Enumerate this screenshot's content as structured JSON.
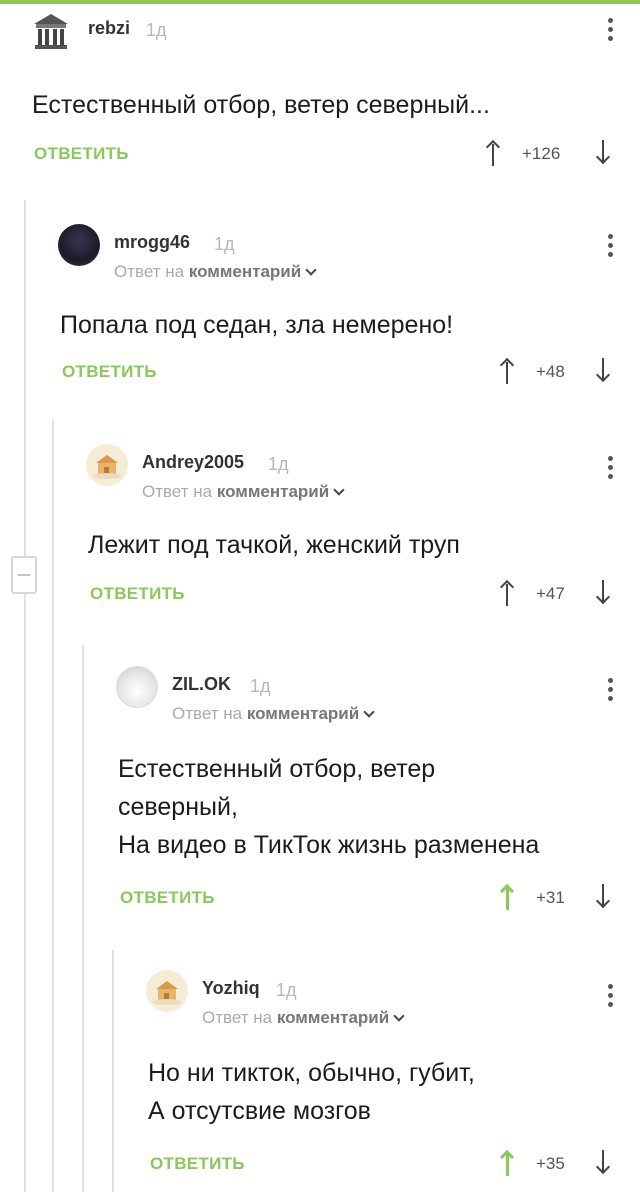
{
  "comments": [
    {
      "username": "rebzi",
      "time": "1д",
      "reply_to": null,
      "text": "Естественный отбор, ветер северный...",
      "reply_label": "ОТВЕТИТЬ",
      "rating": "+126",
      "upvoted": false,
      "avatar": "building-avatar"
    },
    {
      "username": "mrogg46",
      "time": "1д",
      "reply_to": {
        "prefix": "Ответ на",
        "target": "комментарий"
      },
      "text": "Попала под седан, зла немерено!",
      "reply_label": "ОТВЕТИТЬ",
      "rating": "+48",
      "upvoted": false,
      "avatar": "dark-photo-avatar"
    },
    {
      "username": "Andrey2005",
      "time": "1д",
      "reply_to": {
        "prefix": "Ответ на",
        "target": "комментарий"
      },
      "text": "Лежит под тачкой, женский труп",
      "reply_label": "ОТВЕТИТЬ",
      "rating": "+47",
      "upvoted": false,
      "avatar": "default-avatar"
    },
    {
      "username": "ZIL.OK",
      "time": "1д",
      "reply_to": {
        "prefix": "Ответ на",
        "target": "комментарий"
      },
      "text": "Естественный отбор, ветер\nсеверный,\nНа видео в ТикТок жизнь разменена",
      "reply_label": "ОТВЕТИТЬ",
      "rating": "+31",
      "upvoted": true,
      "avatar": "grey-photo-avatar"
    },
    {
      "username": "Yozhiq",
      "time": "1д",
      "reply_to": {
        "prefix": "Ответ на",
        "target": "комментарий"
      },
      "text": "Но ни тикток, обычно, губит,\nА отсутсвие мозгов",
      "reply_label": "ОТВЕТИТЬ",
      "rating": "+35",
      "upvoted": true,
      "avatar": "default-avatar"
    }
  ],
  "colors": {
    "accent": "#8ac858",
    "text": "#1c1c1c",
    "muted": "#aaaaaa",
    "thread_line": "#e0e0e0"
  }
}
